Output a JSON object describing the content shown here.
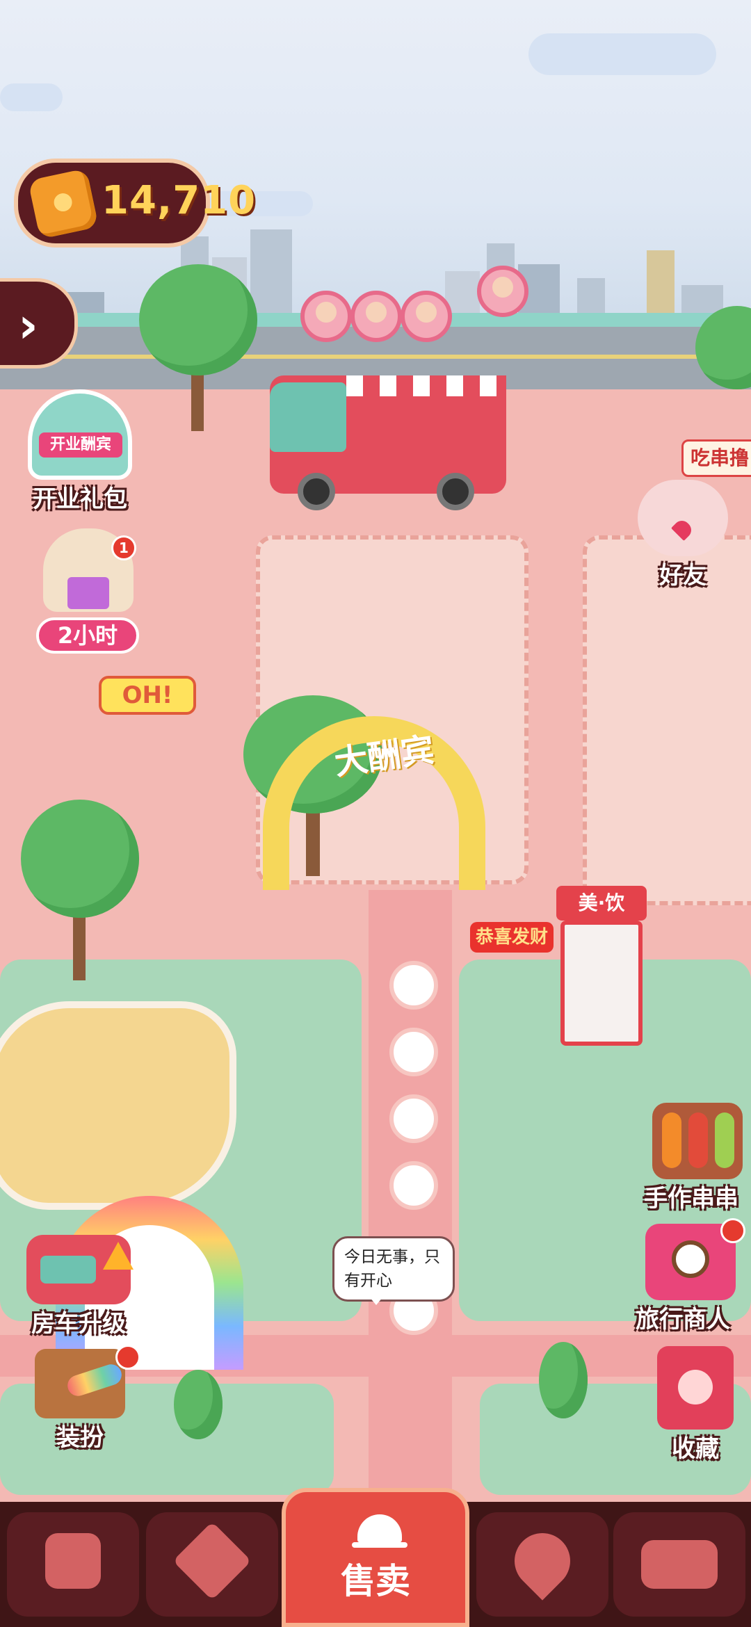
{
  "hud": {
    "coins": "14,710"
  },
  "left_buttons": [
    {
      "label": "开业礼包",
      "banner": "开业酬宾",
      "icon": "wreath-gift-icon"
    },
    {
      "label": "2小时",
      "icon": "cat-gift-icon",
      "badge": "1"
    },
    {
      "label": "房车升级",
      "icon": "rv-upgrade-icon"
    },
    {
      "label": "装扮",
      "icon": "paint-roller-bench-icon"
    }
  ],
  "right_buttons": [
    {
      "label": "好友",
      "icon": "friends-icon"
    },
    {
      "label": "手作串串",
      "icon": "skewers-icon"
    },
    {
      "label": "旅行商人",
      "icon": "compass-map-icon"
    },
    {
      "label": "收藏",
      "icon": "collection-book-icon"
    }
  ],
  "scene": {
    "arch_text": "大酬宾",
    "mascot_banner": "恭喜发财",
    "shop_sign_bar": "OH!",
    "shop_sign_snack": "吃串撸",
    "vending_sign": "美·饮",
    "speech_bubble": "今日无事，只有开心"
  },
  "tabbar": {
    "sell_label": "售卖",
    "tabs": [
      {
        "icon": "shopping-bag-icon"
      },
      {
        "icon": "handshake-icon"
      },
      {
        "icon": "sell-bell-icon"
      },
      {
        "icon": "map-pin-icon"
      },
      {
        "icon": "bus-icon"
      }
    ]
  },
  "colors": {
    "hud_bg": "#5b1b21",
    "coin_text": "#ffd35a",
    "sell_button": "#e64d43",
    "plaza": "#f3b9b4"
  }
}
